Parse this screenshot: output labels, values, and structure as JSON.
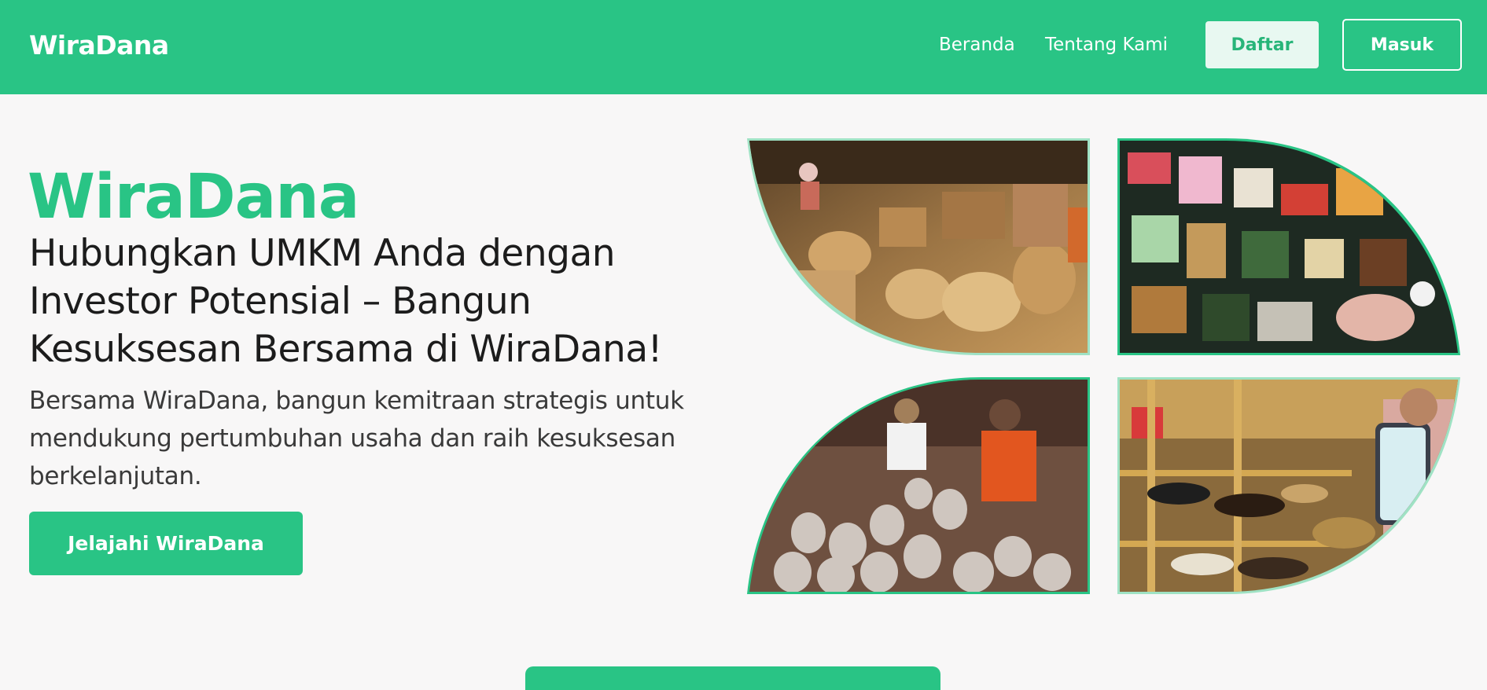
{
  "navbar": {
    "brand": "WiraDana",
    "links": [
      "Beranda",
      "Tentang Kami"
    ],
    "register_label": "Daftar",
    "login_label": "Masuk",
    "background_color": "#29c485"
  },
  "hero": {
    "title": "WiraDana",
    "heading": "Hubungkan UMKM Anda dengan Investor Potensial – Bangun Kesuksesan Bersama di WiraDana!",
    "description": "Bersama WiraDana, bangun kemitraan strategis untuk mendukung pertumbuhan usaha dan raih kesuksesan berkelanjutan.",
    "cta_label": "Jelajahi WiraDana",
    "accent_color": "#29c485"
  },
  "gallery": {
    "images": [
      {
        "subject": "woven baskets market"
      },
      {
        "subject": "traditional snacks stall"
      },
      {
        "subject": "pottery artisans"
      },
      {
        "subject": "shoe shop with smartphone"
      }
    ]
  }
}
